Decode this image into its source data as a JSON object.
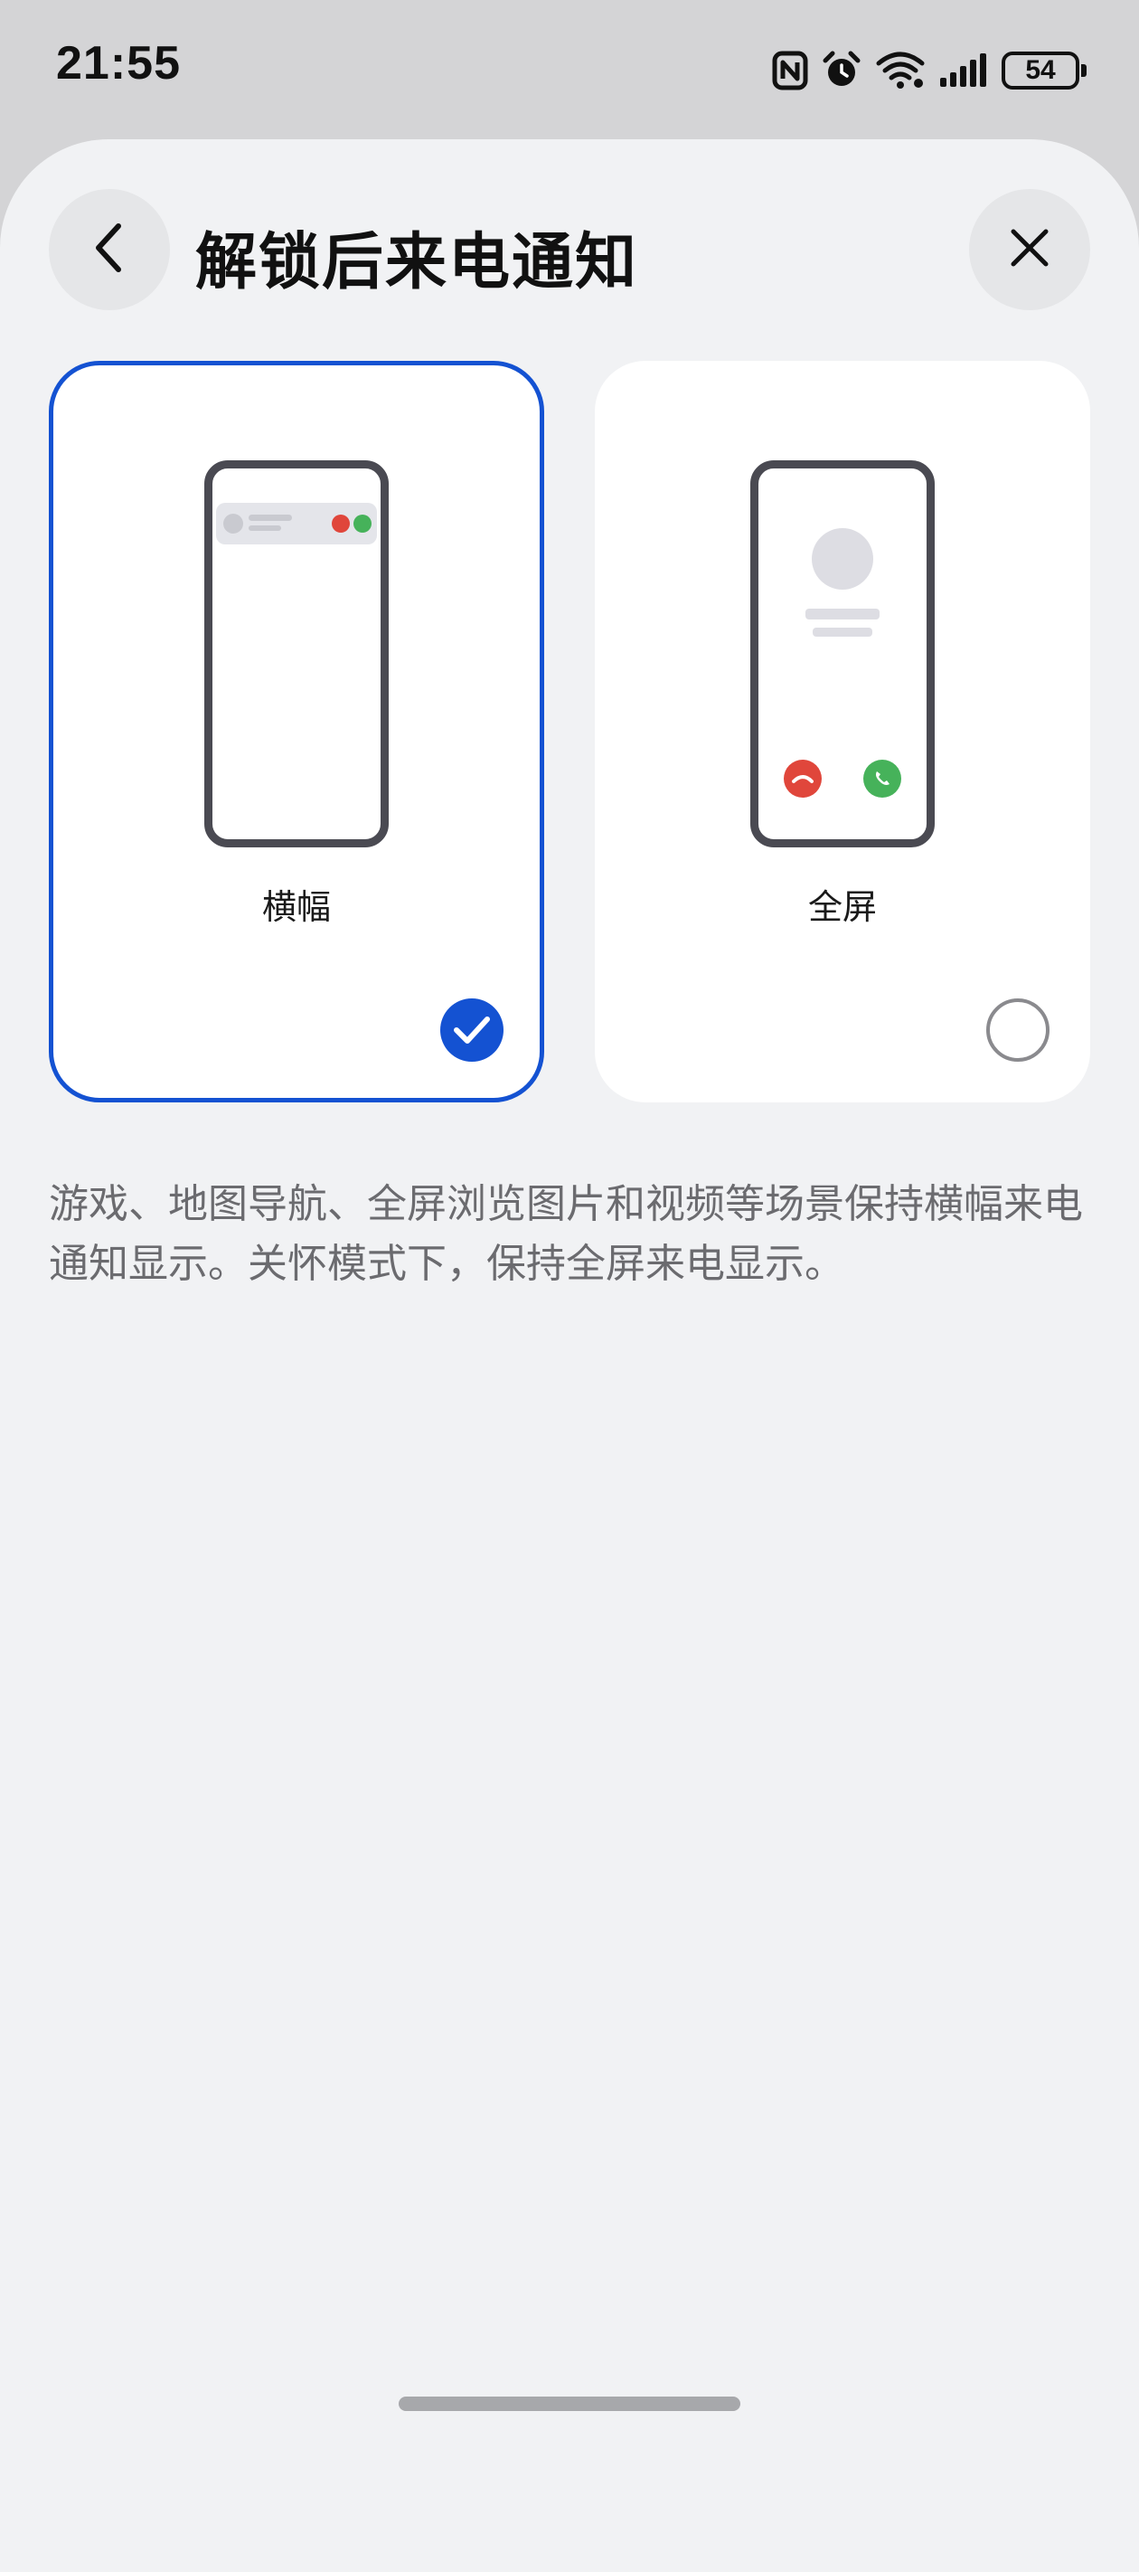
{
  "status_bar": {
    "time": "21:55",
    "battery": "54",
    "icons": [
      "nfc-icon",
      "alarm-icon",
      "wifi-icon",
      "signal-icon",
      "battery-icon"
    ]
  },
  "header": {
    "title": "解锁后来电通知",
    "back_icon": "chevron-left-icon",
    "close_icon": "close-icon"
  },
  "options": [
    {
      "label": "横幅",
      "selected": true
    },
    {
      "label": "全屏",
      "selected": false
    }
  ],
  "description": "游戏、地图导航、全屏浏览图片和视频等场景保持横幅来电通知显示。关怀模式下，保持全屏来电显示。",
  "colors": {
    "accent": "#1452d2",
    "decline": "#e0463b",
    "accept": "#46b25a"
  }
}
